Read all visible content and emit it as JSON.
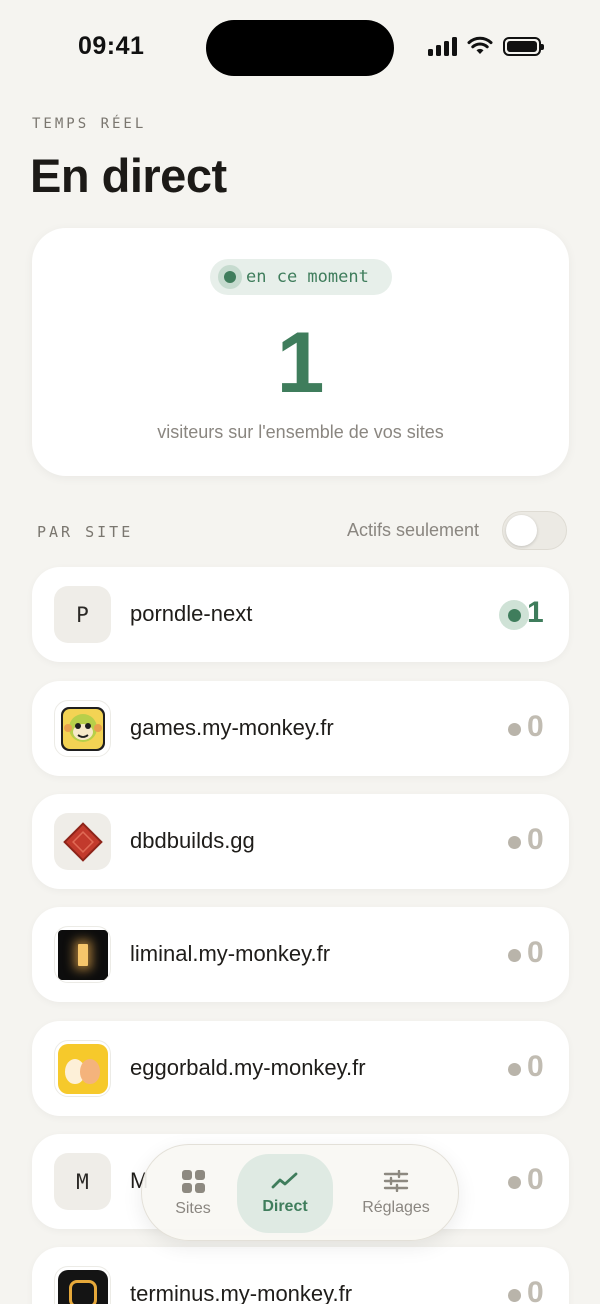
{
  "status_bar": {
    "time": "09:41"
  },
  "header": {
    "eyebrow": "TEMPS RÉEL",
    "title": "En direct"
  },
  "live_card": {
    "pill_label": "en ce moment",
    "visitor_count": "1",
    "subtitle": "visiteurs sur l'ensemble de vos sites"
  },
  "sites_section": {
    "label": "PAR SITE",
    "filter_label": "Actifs seulement",
    "filter_on": false
  },
  "sites": [
    {
      "letter": "P",
      "name": "porndle-next",
      "count": "1",
      "active": true,
      "icon": "letter"
    },
    {
      "letter": "",
      "name": "games.my-monkey.fr",
      "count": "0",
      "active": false,
      "icon": "monkey-icon"
    },
    {
      "letter": "",
      "name": "dbdbuilds.gg",
      "count": "0",
      "active": false,
      "icon": "red-diamond-icon"
    },
    {
      "letter": "",
      "name": "liminal.my-monkey.fr",
      "count": "0",
      "active": false,
      "icon": "dark-doorway-icon"
    },
    {
      "letter": "",
      "name": "eggorbald.my-monkey.fr",
      "count": "0",
      "active": false,
      "icon": "eggs-icon"
    },
    {
      "letter": "M",
      "name": "M",
      "count": "0",
      "active": false,
      "icon": "letter"
    },
    {
      "letter": "",
      "name": "terminus.my-monkey.fr",
      "count": "0",
      "active": false,
      "icon": "terminus-icon"
    }
  ],
  "tab_bar": {
    "tabs": [
      {
        "label": "Sites",
        "icon": "grid-icon"
      },
      {
        "label": "Direct",
        "icon": "trend-line-icon"
      },
      {
        "label": "Réglages",
        "icon": "sliders-icon"
      }
    ],
    "active": "Direct"
  },
  "colors": {
    "accent": "#3f7d5c",
    "background": "#f5f4f0",
    "muted": "#8a8680"
  }
}
